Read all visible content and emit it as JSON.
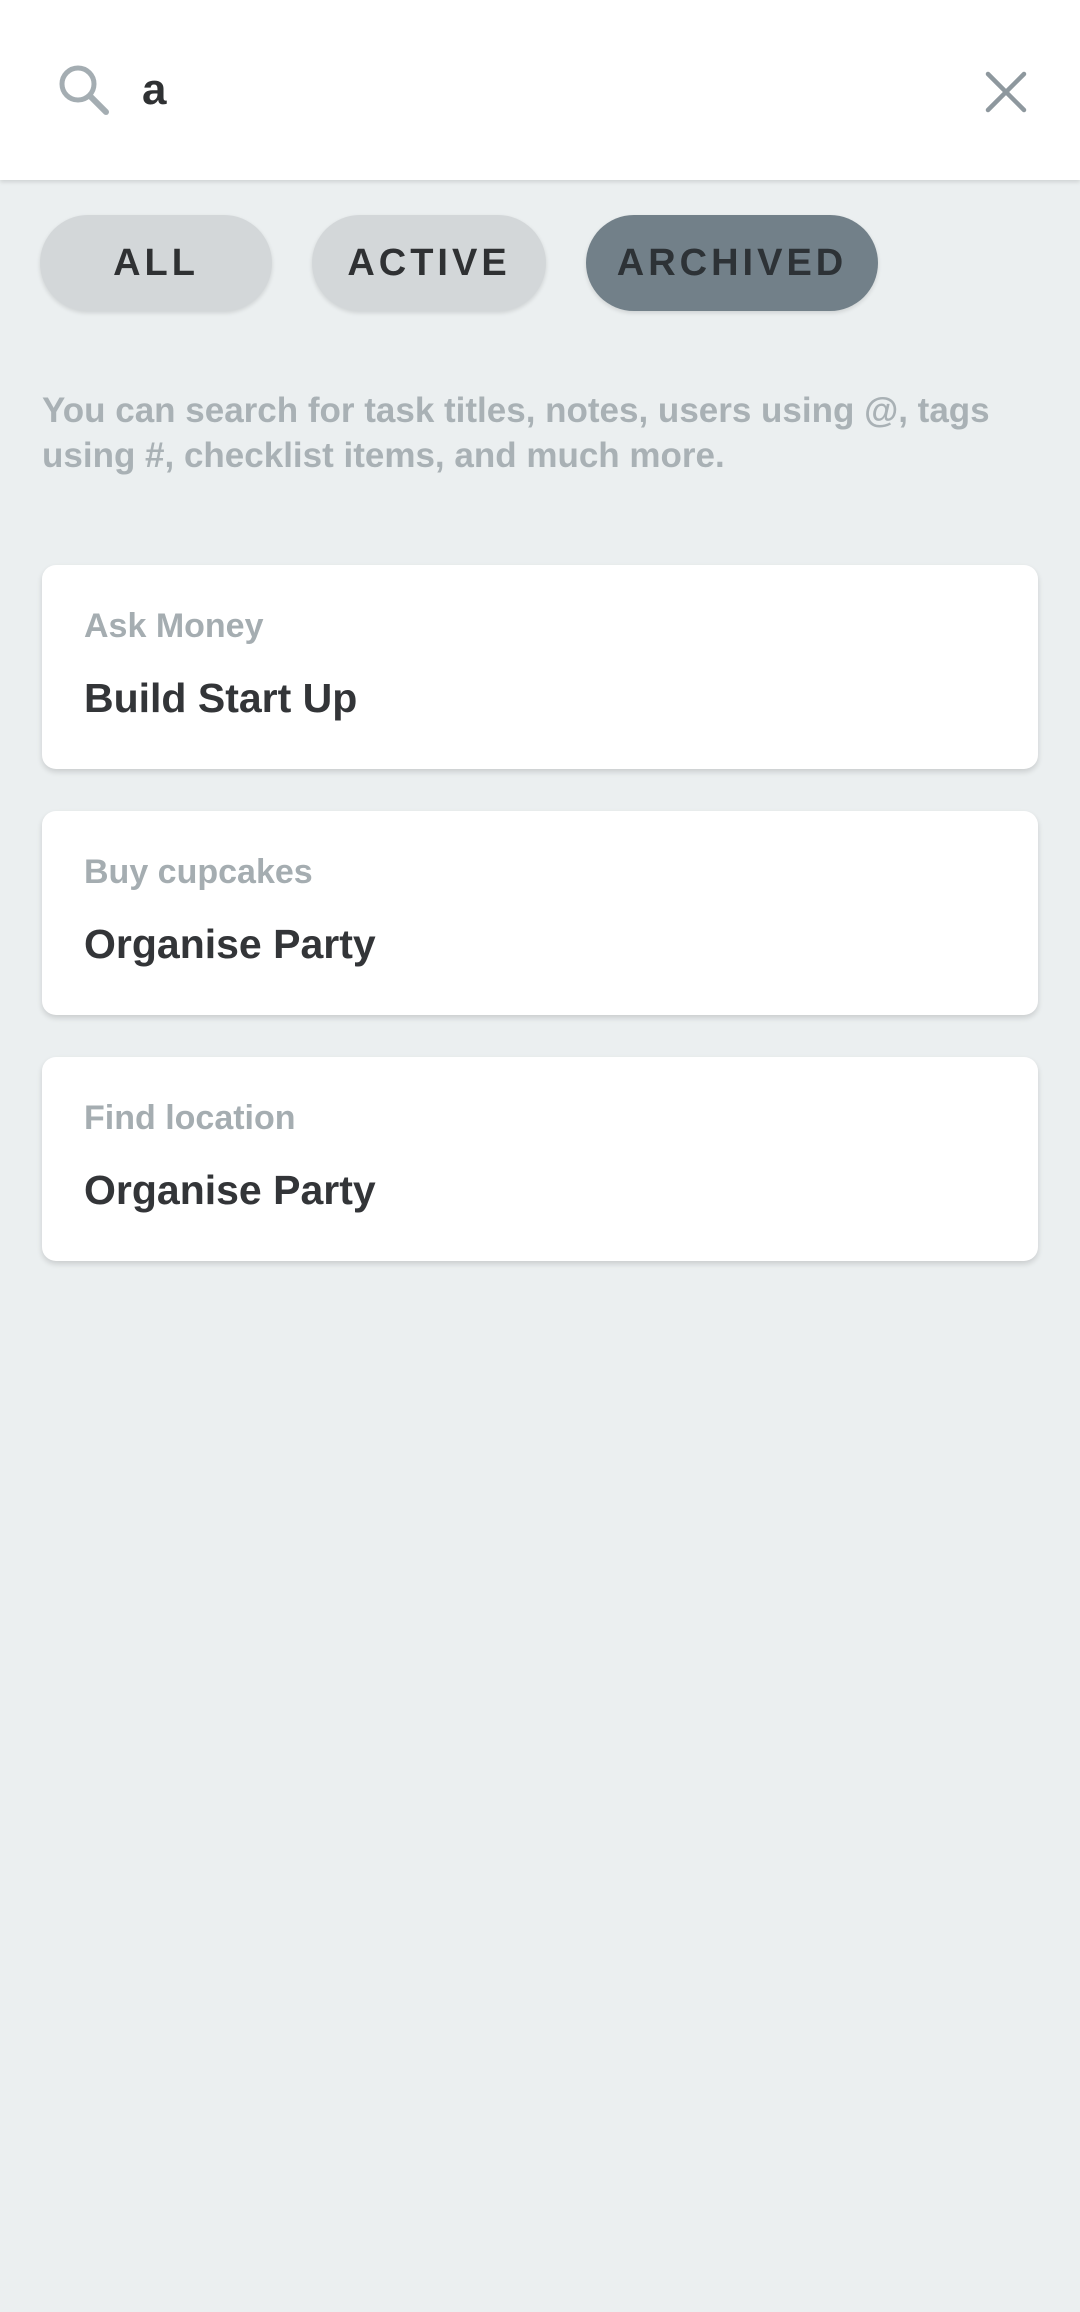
{
  "search": {
    "value": "a",
    "icon": "search-icon",
    "clear_icon": "close-icon"
  },
  "filters": [
    {
      "label": "ALL",
      "selected": false
    },
    {
      "label": "ACTIVE",
      "selected": false
    },
    {
      "label": "ARCHIVED",
      "selected": true
    }
  ],
  "hint": "You can search for task titles, notes, users using @, tags using #, checklist items, and much more.",
  "results": [
    {
      "subtitle": "Ask Money",
      "title": "Build Start Up"
    },
    {
      "subtitle": "Buy cupcakes",
      "title": "Organise Party"
    },
    {
      "subtitle": "Find location",
      "title": "Organise Party"
    }
  ],
  "colors": {
    "background": "#ebeff0",
    "chip": "#d3d7d9",
    "chip_selected": "#728089",
    "muted_text": "#a9b1b5",
    "title_text": "#333538"
  }
}
